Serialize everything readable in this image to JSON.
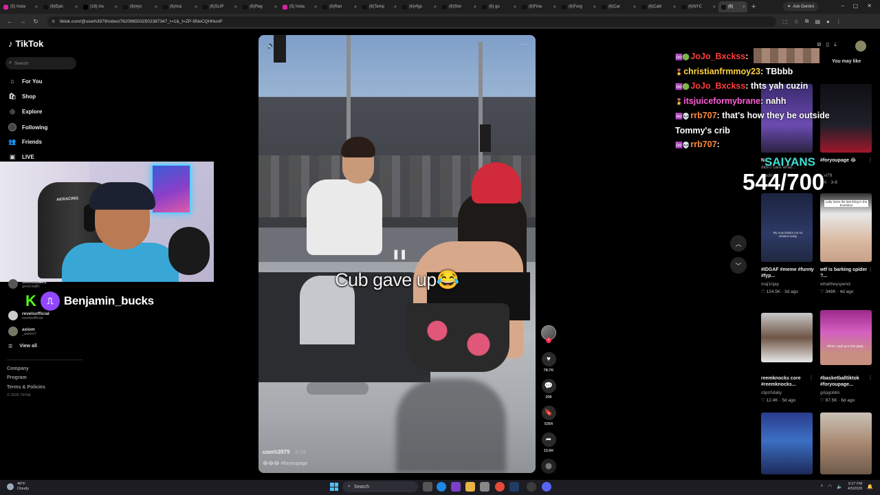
{
  "browser": {
    "tabs": [
      {
        "label": "(5) Insta",
        "icon": "instagram-icon"
      },
      {
        "label": "(6)Epic",
        "icon": "tiktok-icon"
      },
      {
        "label": "(18) ins",
        "icon": "x-icon"
      },
      {
        "label": "(6)#yo",
        "icon": "tiktok-icon"
      },
      {
        "label": "(6)#ca",
        "icon": "tiktok-icon"
      },
      {
        "label": "(6)SLIP",
        "icon": "tiktok-icon"
      },
      {
        "label": "(6)Play",
        "icon": "tiktok-icon"
      },
      {
        "label": "(5) Insta",
        "icon": "instagram-icon"
      },
      {
        "label": "(6)Ran",
        "icon": "tiktok-icon"
      },
      {
        "label": "(6)Temp",
        "icon": "tiktok-icon"
      },
      {
        "label": "(6)#fyp",
        "icon": "tiktok-icon"
      },
      {
        "label": "(6)Stor",
        "icon": "tiktok-icon"
      },
      {
        "label": "(6) gu",
        "icon": "tiktok-icon"
      },
      {
        "label": "(6)Fina",
        "icon": "tiktok-icon"
      },
      {
        "label": "(6)Forg",
        "icon": "tiktok-icon"
      },
      {
        "label": "(6)Car",
        "icon": "tiktok-icon"
      },
      {
        "label": "(6)Calli",
        "icon": "tiktok-icon"
      },
      {
        "label": "(6)NYC",
        "icon": "tiktok-icon"
      },
      {
        "label": "(6)",
        "icon": "tiktok-icon",
        "active": true
      }
    ],
    "new_tab": "+",
    "ask_gemini": "Ask Gemini",
    "url": "tiktok.com/@userh3979/video/7620965032502387347_r=1&_t=ZP-95leCQHHunP"
  },
  "tiktok": {
    "logo": "TikTok",
    "search_placeholder": "Search",
    "nav": [
      {
        "label": "For You",
        "icon": "home-icon"
      },
      {
        "label": "Shop",
        "icon": "shop-icon"
      },
      {
        "label": "Explore",
        "icon": "compass-icon"
      },
      {
        "label": "Following",
        "icon": "following-avatar-icon"
      },
      {
        "label": "Friends",
        "icon": "friends-icon"
      },
      {
        "label": "LIVE",
        "icon": "live-icon"
      }
    ],
    "following": [
      {
        "name": "Gooodball1",
        "sub": "good.ball0"
      },
      {
        "name": "revelsofficial",
        "sub": "revelsofficial"
      },
      {
        "name": "axiom",
        "sub": "_axiom7"
      }
    ],
    "view_all": "View all",
    "footer": [
      "Company",
      "Program",
      "Terms & Policies"
    ],
    "copyright": "© 2026 TikTok"
  },
  "streamer": {
    "kick_letter": "K",
    "handle": "Benjamin_bucks",
    "chair_brand": "AKRACING"
  },
  "video": {
    "caption": "Cub gave up😂",
    "author": "userh3979",
    "date": "· 3-24",
    "description": "😂😂😂 #foryoupage",
    "actions": [
      {
        "name": "like",
        "icon": "♥",
        "count": "78.7K"
      },
      {
        "name": "comment",
        "icon": "💬",
        "count": "306"
      },
      {
        "name": "save",
        "icon": "🔖",
        "count": "5354"
      },
      {
        "name": "share",
        "icon": "➦",
        "count": "13.6K"
      }
    ]
  },
  "chat": {
    "messages": [
      {
        "badges": "♾️🟢",
        "user": "JoJo_Bxckss",
        "user_color": "#ff3b3b",
        "text": ""
      },
      {
        "badges": "🎖️",
        "user": "christianfrmmoy23",
        "user_color": "#ffd23f",
        "text": "TBbbb"
      },
      {
        "badges": "♾️🟢",
        "user": "JoJo_Bxckss",
        "user_color": "#ff3b3b",
        "text": "thts yah cuzin"
      },
      {
        "badges": "🎖️",
        "user": "itsjuiceformybrane",
        "user_color": "#ff5fd8",
        "text": "nahh"
      },
      {
        "badges": "♾️💀",
        "user": "rrb707",
        "user_color": "#ff8a3d",
        "text": "that's how they be outside Tommy's crib"
      },
      {
        "badges": "♾️💀",
        "user": "rrb707",
        "user_color": "#ff8a3d",
        "text": ""
      }
    ],
    "goal_label": "SAIYANS",
    "goal_count": "544/700"
  },
  "sidebar_right": {
    "you_may_like": "You may like",
    "cards": [
      {
        "title": "N...",
        "sub": "didn't care what...",
        "user": "reading...",
        "stats": "",
        "more": "⋮"
      },
      {
        "title": "#foryoupage 😂",
        "sub": "",
        "user": "...vi79",
        "stats": "...K · 3-8",
        "more": "⋮"
      },
      {
        "title": "#IDGAF #meme #funny #fyp...",
        "user": "maj1njay",
        "stats": "♡ 124.5K · 3d ago",
        "more": "⋮"
      },
      {
        "title": "wtf is barking spider ?...",
        "user": "whattheyspend",
        "stats": "♡ 348K · 4d ago",
        "more": "⋮"
      },
      {
        "title": "reemknocks core #reemknocks...",
        "user": "clipz0daily",
        "stats": "♡ 12.4K · 5d ago",
        "more": "⋮"
      },
      {
        "title": "#basketballtiktok #foryoupage...",
        "user": "gripgoblin",
        "stats": "♡ 87.5K · 6d ago",
        "more": "⋮"
      }
    ],
    "thumb_texts": [
      "My nonchalant not so chalant today",
      "Lady loses the last thing in the boombox",
      "When I pull up to the party..."
    ]
  },
  "taskbar": {
    "weather_temp": "49°F",
    "weather_desc": "Cloudy",
    "search": "Search",
    "time": "9:27 PM",
    "date": "4/5/2026"
  },
  "colors": {
    "tiktok_red": "#fe2c55",
    "twitch_purple": "#9146ff",
    "kick_green": "#53fc18",
    "saiyans_teal": "#3fe0d6"
  }
}
